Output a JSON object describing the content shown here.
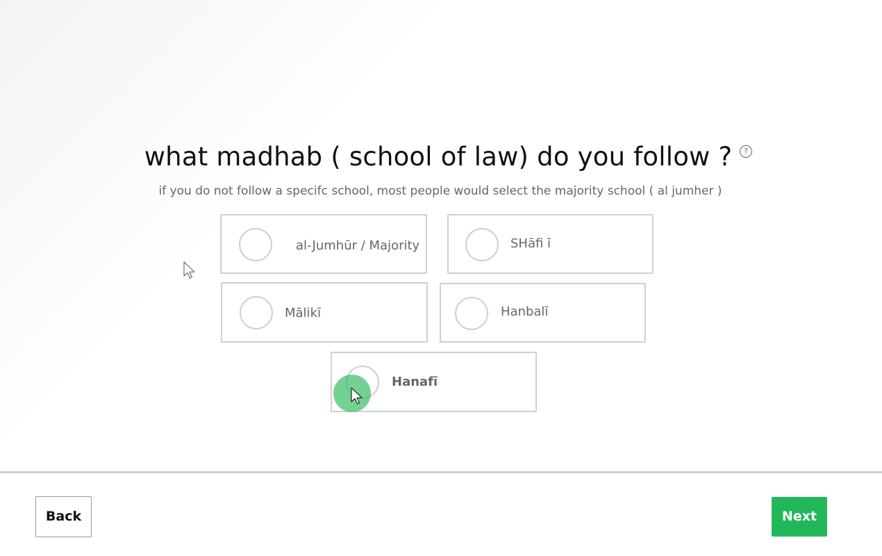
{
  "question": {
    "title": "what madhab ( school of law) do you follow ?",
    "help_icon": "?",
    "subtitle": "if you do not follow a specifc school, most people would select the majority school ( al jumher )"
  },
  "options": [
    {
      "label": "al-Jumhūr / Majority",
      "selected": false
    },
    {
      "label": "SHāfi ī",
      "selected": false
    },
    {
      "label": "Mālikī",
      "selected": false
    },
    {
      "label": "Hanbalī",
      "selected": false
    },
    {
      "label": "Hanafī",
      "selected": true
    }
  ],
  "footer": {
    "back_label": "Back",
    "next_label": "Next"
  },
  "colors": {
    "accent": "#23b75b",
    "border": "#d0d0d0",
    "text_muted": "#666666"
  },
  "icons": {
    "help": "question-circle-icon",
    "pointer": "mouse-pointer-icon"
  }
}
